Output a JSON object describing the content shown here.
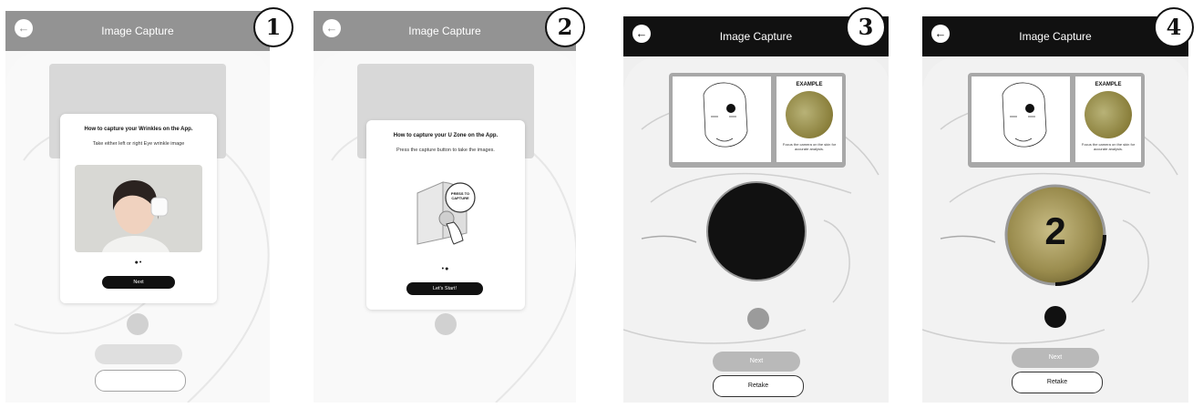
{
  "screen_title": "Image Capture",
  "steps": [
    "1",
    "2",
    "3",
    "4"
  ],
  "panel1": {
    "modal_title": "How to capture your Wrinkles on the App.",
    "modal_sub": "Take either left or right Eye wrinkle image",
    "dots": "●•",
    "button": "Next"
  },
  "panel2": {
    "modal_title": "How to capture your U Zone on the App.",
    "modal_sub": "Press the capture button to take the images.",
    "device_label": "PRESS TO CAPTURE",
    "dots": "•●",
    "button": "Let's Start!"
  },
  "reference": {
    "example_label": "EXAMPLE",
    "caption": "Focus the camera on the skin for accurate analysis."
  },
  "panel3": {
    "next": "Next",
    "retake": "Retake"
  },
  "panel4": {
    "countdown": "2",
    "next": "Next",
    "retake": "Retake"
  },
  "colors": {
    "bar": "#111111",
    "accent_disabled": "#b9b9b9",
    "background": "#f2f2f2"
  }
}
